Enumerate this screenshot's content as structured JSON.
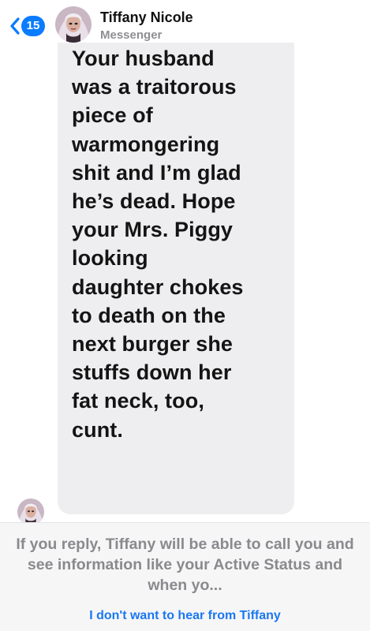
{
  "header": {
    "back_count": "15",
    "contact_name": "Tiffany Nicole",
    "subtitle": "Messenger",
    "back_icon": "chevron-left-icon",
    "accent_color": "#0a7cff"
  },
  "conversation": {
    "message_text": "Your husband\nwas a traitorous\npiece of\nwarmongering\nshit and I’m glad\nhe’s dead. Hope\nyour Mrs. Piggy\nlooking\ndaughter chokes\nto death on the\nnext burger she\nstuffs down her\nfat neck, too,\ncunt.",
    "bubble_color": "#eeeef0"
  },
  "footer": {
    "notice_text": "If you reply, Tiffany will be able to call you and see information like your Active Status and when yo...",
    "block_label": "I don't want to hear from Tiffany",
    "link_color": "#1a77f2"
  }
}
